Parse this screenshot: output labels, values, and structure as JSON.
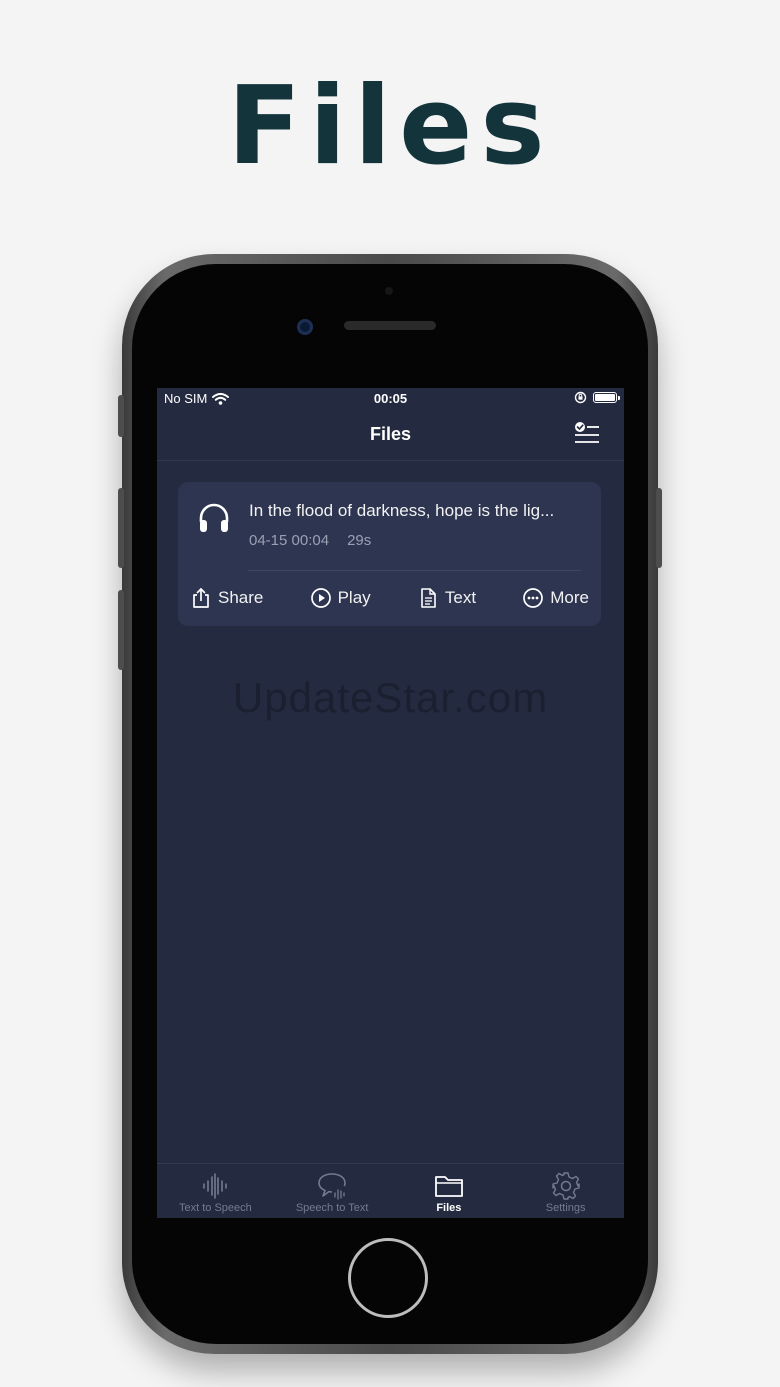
{
  "promo": {
    "title": "Files"
  },
  "status_bar": {
    "carrier": "No SIM",
    "time": "00:05"
  },
  "nav": {
    "title": "Files",
    "action_icon": "checklist-icon"
  },
  "files": [
    {
      "text": "In the flood of darkness, hope is the lig...",
      "date": "04-15 00:04",
      "duration": "29s",
      "icon": "headphones-icon",
      "actions": {
        "share": "Share",
        "play": "Play",
        "text": "Text",
        "more": "More"
      }
    }
  ],
  "watermark": "UpdateStar.com",
  "tabs": [
    {
      "label": "Text to Speech",
      "icon": "waveform-icon",
      "active": false
    },
    {
      "label": "Speech to Text",
      "icon": "speech-bubble-icon",
      "active": false
    },
    {
      "label": "Files",
      "icon": "folder-icon",
      "active": true
    },
    {
      "label": "Settings",
      "icon": "gear-icon",
      "active": false
    }
  ],
  "colors": {
    "screen_bg": "#242a40",
    "card_bg": "#2e3551",
    "title_color": "#13343b",
    "inactive_tab": "#747a8f"
  }
}
